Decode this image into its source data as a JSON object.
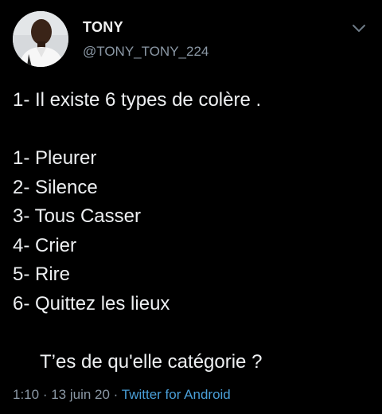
{
  "user": {
    "display_name": "TONY",
    "handle": "@TONY_TONY_224"
  },
  "tweet": {
    "lines": [
      "1- Il existe 6 types de colère .",
      "",
      "1- Pleurer",
      "2- Silence",
      "3- Tous Casser",
      "4- Crier",
      "5- Rire",
      "6- Quittez les lieux",
      "",
      "T’es de qu'elle catégorie ?"
    ]
  },
  "meta": {
    "time": "1:10",
    "separator1": " · ",
    "date": "13 juin 20",
    "separator2": " · ",
    "source": "Twitter for Android"
  },
  "icons": {
    "menu": "chevron-down-icon"
  },
  "colors": {
    "background": "#000000",
    "text": "#e7e9ea",
    "secondary": "#8b98a5",
    "link": "#4a9fd8"
  }
}
